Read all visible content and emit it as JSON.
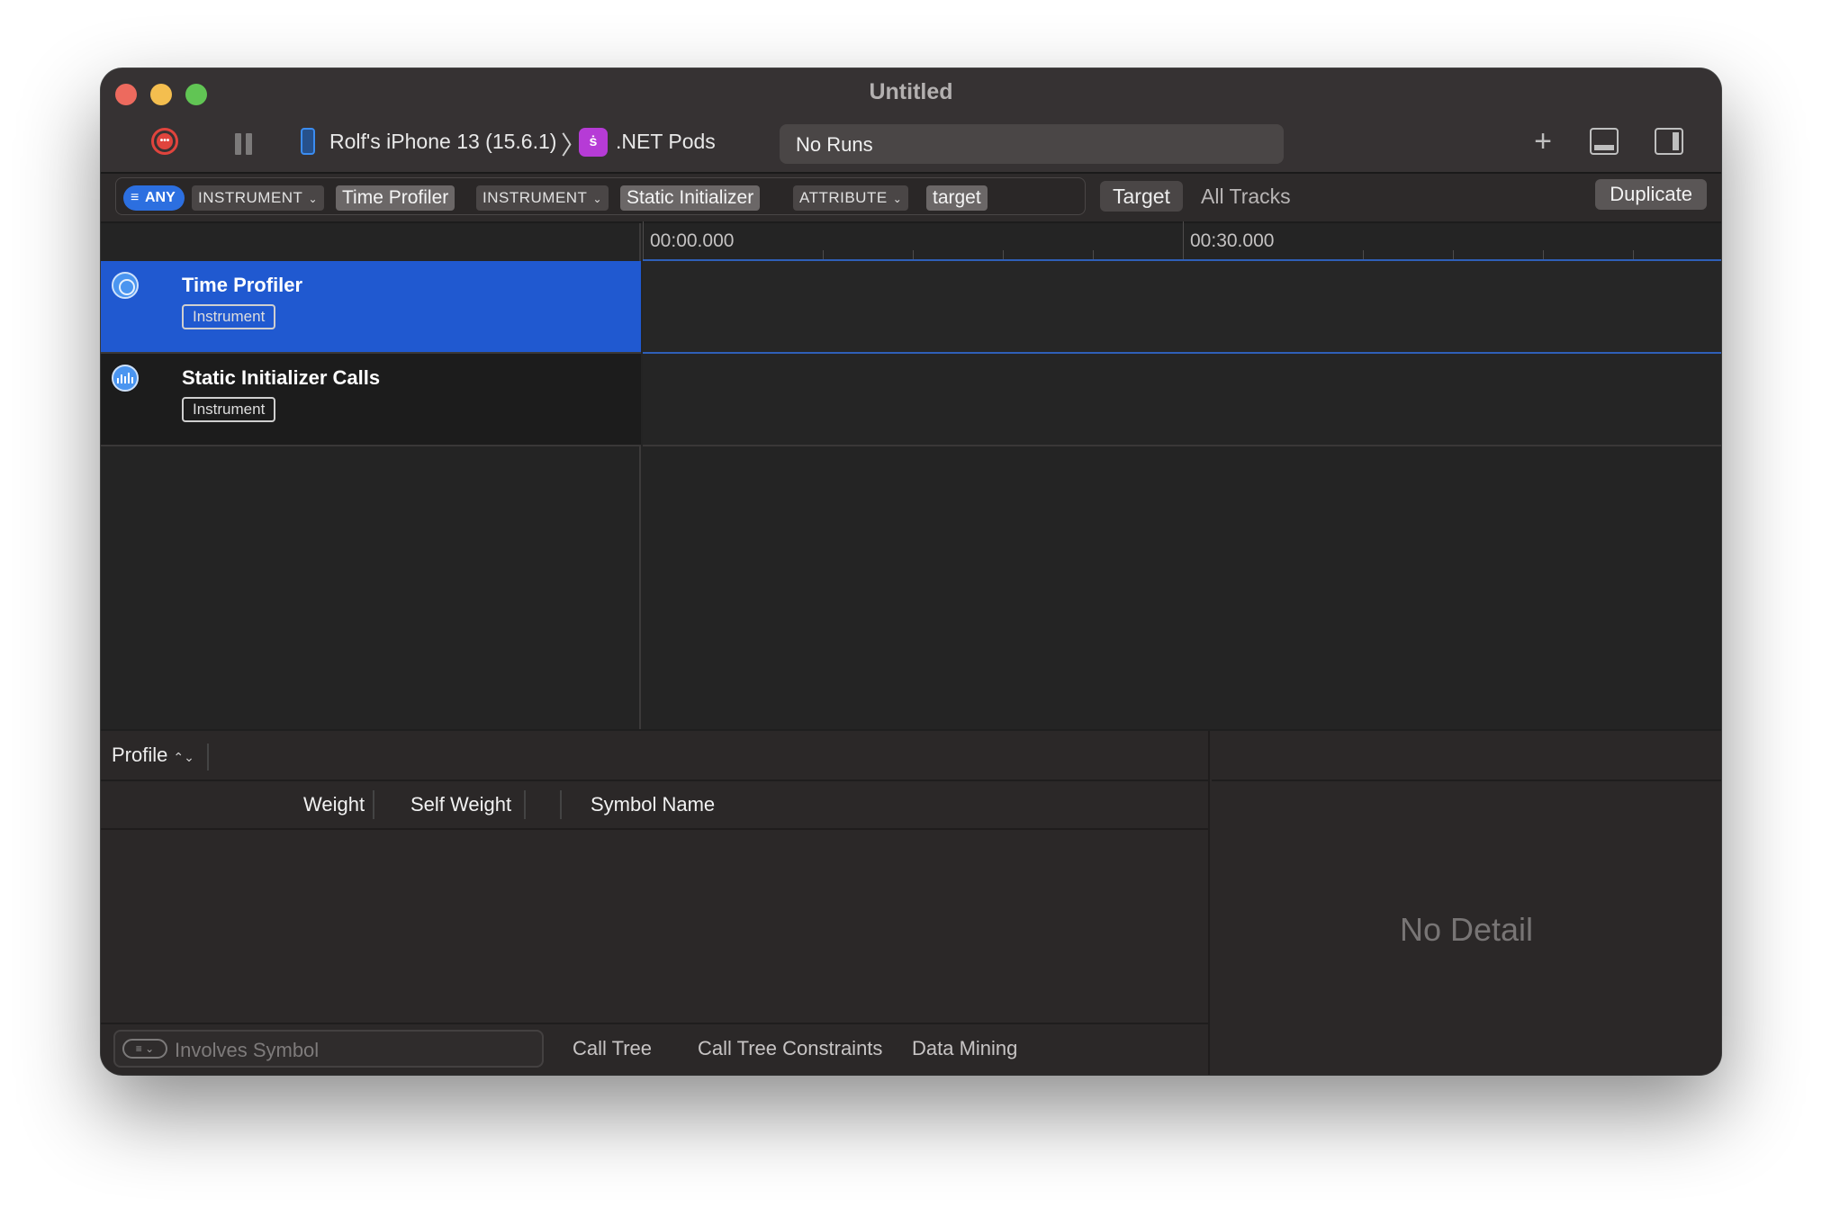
{
  "window": {
    "title": "Untitled"
  },
  "toolbar": {
    "record_icon": "record-icon",
    "pause_icon": "pause-icon",
    "device": "Rolf's iPhone 13 (15.6.1)",
    "separator": "〉",
    "app_icon_glyph": "ṡ",
    "app": ".NET Pods",
    "runs": "No Runs",
    "plus": "+"
  },
  "filter": {
    "any": "ANY",
    "chips": [
      {
        "key": "INSTRUMENT",
        "value": "Time Profiler"
      },
      {
        "key": "INSTRUMENT",
        "value": "Static Initializer"
      },
      {
        "key": "ATTRIBUTE",
        "value": "target"
      }
    ],
    "chevron": "⌄",
    "scope_target": "Target",
    "scope_all": "All Tracks",
    "duplicate": "Duplicate"
  },
  "timeline": {
    "labels": [
      "00:00.000",
      "00:30.000"
    ]
  },
  "tracks": [
    {
      "title": "Time Profiler",
      "badge": "Instrument",
      "selected": true
    },
    {
      "title": "Static Initializer Calls",
      "badge": "Instrument",
      "selected": false
    }
  ],
  "detail": {
    "profile": "Profile",
    "updown": "⌃⌄",
    "columns": [
      "Weight",
      "Self Weight",
      "Symbol Name"
    ],
    "search_placeholder": "Involves Symbol",
    "filter_glyph": "≡ ⌄",
    "tabs": [
      "Call Tree",
      "Call Tree Constraints",
      "Data Mining"
    ],
    "no_detail": "No Detail"
  },
  "colors": {
    "accent": "#2059d0",
    "any_chip": "#2c6fe0",
    "record": "#e0443d",
    "app_icon": "#b63bd6"
  }
}
